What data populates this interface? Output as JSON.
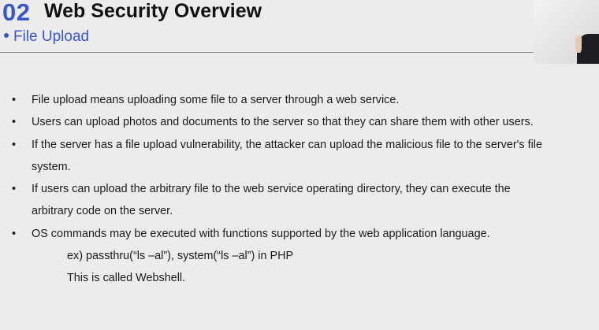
{
  "header": {
    "number": "02",
    "title": "Web Security Overview",
    "subtitle": "File Upload"
  },
  "bullets": [
    {
      "line1": "File upload means uploading some file to a server through a web service.",
      "line2": ""
    },
    {
      "line1": "Users can upload photos and documents to the server so that they can share them with other users.",
      "line2": ""
    },
    {
      "line1": "If the server has a file upload vulnerability, the attacker can upload the malicious file to the server's file",
      "line2": "system."
    },
    {
      "line1": "If users can upload the arbitrary file to the web service operating directory, they can execute the",
      "line2": "arbitrary code on the server."
    },
    {
      "line1": "OS commands may be executed with functions supported by the web application language.",
      "line2": ""
    }
  ],
  "sub_lines": [
    "ex) passthru(“ls –al”), system(“ls –al”) in PHP",
    "This is called Webshell."
  ],
  "bullet_glyph": "•",
  "colors": {
    "accent": "#3a56c8",
    "background": "#ececec",
    "text": "#1a1a1a"
  }
}
